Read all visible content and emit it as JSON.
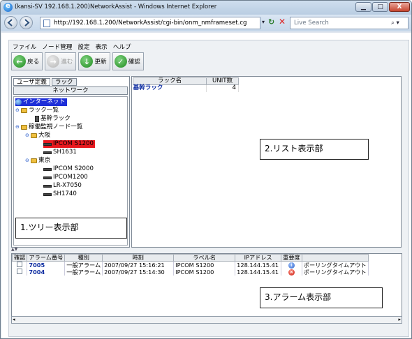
{
  "window": {
    "title": "(kansi-SV 192.168.1.200)NetworkAssist - Windows Internet Explorer",
    "min_label": "▁",
    "max_label": "□",
    "close_label": "X"
  },
  "addressbar": {
    "url": "http://192.168.1.200/NetworkAssist/cgi-bin/onm_nmframeset.cg",
    "search_placeholder": "Live Search"
  },
  "menu": [
    "ファイル",
    "ノード管理",
    "設定",
    "表示",
    "ヘルプ"
  ],
  "toolbar": {
    "back": "戻る",
    "forward": "進む",
    "refresh": "更新",
    "confirm": "確認"
  },
  "tabs": {
    "user_defined": "ユーザ定義",
    "rack": "ラック",
    "network": "ネットワーク"
  },
  "tree": {
    "root": "インターネット",
    "rack_list": "ラック一覧",
    "core_rack": "基幹ラック",
    "monitored_list": "稼働監視ノード一覧",
    "osaka": "大阪",
    "osaka_nodes": [
      "IPCOM S1200",
      "SH1631"
    ],
    "tokyo": "東京",
    "tokyo_nodes": [
      "IPCOM S2000",
      "IPCOM1200",
      "LR-X7050",
      "SH1740"
    ]
  },
  "rack_table": {
    "headers": [
      "ラック名",
      "UNIT数"
    ],
    "rows": [
      [
        "基幹ラック",
        "4"
      ]
    ]
  },
  "alarm_table": {
    "headers": [
      "確認",
      "アラーム番号",
      "種別",
      "時刻",
      "ラベル名",
      "IPアドレス",
      "重要度",
      ""
    ],
    "rows": [
      {
        "no": "7005",
        "type": "一般アラーム",
        "time": "2007/09/27 15:16:21",
        "label": "IPCOM S1200",
        "ip": "128.144.15.41",
        "severity": "info",
        "message": "ポーリングタイムアウト"
      },
      {
        "no": "7004",
        "type": "一般アラーム",
        "time": "2007/09/27 15:14:30",
        "label": "IPCOM S1200",
        "ip": "128.144.15.41",
        "severity": "error",
        "message": "ポーリングタイムアウト"
      }
    ]
  },
  "callouts": {
    "tree": "1.ツリー表示部",
    "list": "2.リスト表示部",
    "alarm": "3.アラーム表示部"
  },
  "colors": {
    "selected_tree_bg": "#1e2fd8",
    "highlight_node_bg": "#e8191f"
  }
}
